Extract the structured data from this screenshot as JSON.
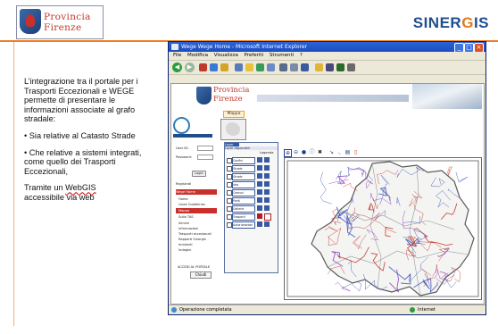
{
  "header": {
    "logo_line1": "Provincia",
    "logo_line2": "Firenze",
    "brand_pre": "SINER",
    "brand_accent": "G",
    "brand_post": "IS",
    "brand_color": "#1f4e8c",
    "accent_color": "#ef7d22"
  },
  "intro": {
    "p1": "L’integrazione tra il portale per i Trasporti Eccezionali e WEGE permette di presentare le informazioni associate al grafo stradale:",
    "p2": "• Sia relative al Catasto Strade",
    "p3": "• Che relative a sistemi integrati, come quello dei Trasporti Eccezionali,",
    "p4_pre": "Tramite un ",
    "p4_link": "WebGIS",
    "p4_post": " accessibile via web"
  },
  "browser": {
    "title": "Wege Wege Home - Microsoft Internet Explorer",
    "menu": [
      "File",
      "Modifica",
      "Visualizza",
      "Preferiti",
      "Strumenti",
      "?"
    ],
    "status_text": "Operazione completata",
    "zone_text": "Internet"
  },
  "page": {
    "banner_line1": "Provincia",
    "banner_line2": "Firenze",
    "mappa_tab": "Mappa",
    "login": {
      "user_label": "User ID:",
      "password_label": "Password:",
      "button": "Login",
      "register": "Registrati"
    },
    "nav": {
      "section_title": "Wege Home",
      "items": [
        "Home",
        "Linee Guidelines",
        "Mappa",
        "Sulla TAS",
        "Servizi",
        "Informazioni",
        "Trasporti eccezionali",
        "Rapporti Sinergis",
        "Incidenti",
        "Indagini"
      ],
      "active_index": 2
    },
    "portal_link": "ACCEDI AL PORTALE",
    "close_button": "Chiudi",
    "layers": {
      "tab": "Layer",
      "header": "Layer disponibili",
      "legend_label": "Legenda",
      "rows": [
        {
          "label": "Confini",
          "swatch": "#3a5aa0"
        },
        {
          "label": "Strade",
          "swatch": "#3a5aa0"
        },
        {
          "label": "Strade regionali",
          "swatch": "#3a5aa0"
        },
        {
          "label": "Idro",
          "swatch": "#3a5aa0"
        },
        {
          "label": "Comuni",
          "swatch": "#3a5aa0"
        },
        {
          "label": "Ponti",
          "swatch": "#3a5aa0"
        },
        {
          "label": "Gallerie",
          "swatch": "#3a5aa0"
        },
        {
          "label": "Trasporti",
          "swatch": "#b01e23"
        },
        {
          "label": "Autorizzazioni",
          "swatch": "#3a5aa0"
        }
      ]
    },
    "map_tools": [
      "zoom-in-icon",
      "zoom-out-icon",
      "pan-icon",
      "info-icon",
      "clear-icon",
      "measure-icon",
      "print-icon"
    ]
  }
}
